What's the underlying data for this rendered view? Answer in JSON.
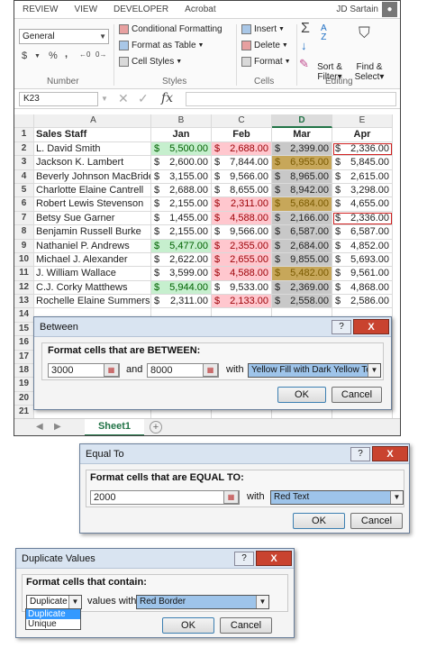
{
  "ribbon_tabs": [
    "REVIEW",
    "VIEW",
    "DEVELOPER",
    "Acrobat"
  ],
  "user": "JD Sartain",
  "number_group": {
    "format_value": "General",
    "label": "Number",
    "currency": "$",
    "percent": "%",
    "comma": ","
  },
  "styles_group": {
    "conditional": "Conditional Formatting",
    "format_table": "Format as Table",
    "cell_styles": "Cell Styles",
    "label": "Styles"
  },
  "cells_group": {
    "insert": "Insert",
    "delete": "Delete",
    "format": "Format",
    "label": "Cells"
  },
  "editing_group": {
    "sort": "Sort &",
    "sort2": "Filter",
    "find": "Find &",
    "find2": "Select",
    "label": "Editing"
  },
  "name_box": "K23",
  "formula_fx": "fx",
  "columns": [
    "A",
    "B",
    "C",
    "D",
    "E"
  ],
  "header_row": {
    "a": "Sales Staff",
    "b": "Jan",
    "c": "Feb",
    "d": "Mar",
    "e": "Apr"
  },
  "rows": [
    {
      "n": "2",
      "name": "L. David Smith",
      "jan": "5,500.00",
      "feb": "2,688.00",
      "mar": "2,399.00",
      "apr": "2,336.00",
      "fb": "green",
      "fc": "pink",
      "fd": "gray",
      "fe": "redborder"
    },
    {
      "n": "3",
      "name": "Jackson K. Lambert",
      "jan": "2,600.00",
      "feb": "7,844.00",
      "mar": "6,955.00",
      "apr": "5,845.00",
      "fb": "",
      "fc": "",
      "fd": "yellow",
      "fe": ""
    },
    {
      "n": "4",
      "name": "Beverly Johnson MacBride",
      "jan": "3,155.00",
      "feb": "9,566.00",
      "mar": "8,965.00",
      "apr": "2,615.00",
      "fb": "",
      "fc": "",
      "fd": "gray",
      "fe": ""
    },
    {
      "n": "5",
      "name": "Charlotte Elaine Cantrell",
      "jan": "2,688.00",
      "feb": "8,655.00",
      "mar": "8,942.00",
      "apr": "3,298.00",
      "fb": "",
      "fc": "",
      "fd": "gray",
      "fe": ""
    },
    {
      "n": "6",
      "name": "Robert Lewis Stevenson",
      "jan": "2,155.00",
      "feb": "2,311.00",
      "mar": "5,684.00",
      "apr": "4,655.00",
      "fb": "",
      "fc": "pink",
      "fd": "yellow",
      "fe": ""
    },
    {
      "n": "7",
      "name": "Betsy Sue Garner",
      "jan": "1,455.00",
      "feb": "4,588.00",
      "mar": "2,166.00",
      "apr": "2,336.00",
      "fb": "",
      "fc": "pink",
      "fd": "gray",
      "fe": "redborder"
    },
    {
      "n": "8",
      "name": "Benjamin Russell Burke",
      "jan": "2,155.00",
      "feb": "9,566.00",
      "mar": "6,587.00",
      "apr": "6,587.00",
      "fb": "",
      "fc": "",
      "fd": "gray",
      "fe": ""
    },
    {
      "n": "9",
      "name": "Nathaniel P. Andrews",
      "jan": "5,477.00",
      "feb": "2,355.00",
      "mar": "2,684.00",
      "apr": "4,852.00",
      "fb": "green",
      "fc": "pink",
      "fd": "gray",
      "fe": ""
    },
    {
      "n": "10",
      "name": "Michael J. Alexander",
      "jan": "2,622.00",
      "feb": "2,655.00",
      "mar": "9,855.00",
      "apr": "5,693.00",
      "fb": "",
      "fc": "pink",
      "fd": "gray",
      "fe": ""
    },
    {
      "n": "11",
      "name": "J. William Wallace",
      "jan": "3,599.00",
      "feb": "4,588.00",
      "mar": "5,482.00",
      "apr": "9,561.00",
      "fb": "",
      "fc": "pink",
      "fd": "yellow",
      "fe": ""
    },
    {
      "n": "12",
      "name": "C.J. Corky Matthews",
      "jan": "5,944.00",
      "feb": "9,533.00",
      "mar": "2,369.00",
      "apr": "4,868.00",
      "fb": "green",
      "fc": "",
      "fd": "gray",
      "fe": ""
    },
    {
      "n": "13",
      "name": "Rochelle Elaine Summers",
      "jan": "2,311.00",
      "feb": "2,133.00",
      "mar": "2,558.00",
      "apr": "2,586.00",
      "fb": "",
      "fc": "pink",
      "fd": "gray",
      "fe": ""
    }
  ],
  "empty_rows": [
    "14",
    "15",
    "16",
    "17",
    "18",
    "19",
    "20",
    "21"
  ],
  "row1": "1",
  "currency_symbol": "$",
  "sheet_tab": "Sheet1",
  "add_sheet": "+",
  "between_dialog": {
    "title": "Between",
    "label": "Format cells that are BETWEEN:",
    "low": "3000",
    "and": "and",
    "high": "8000",
    "with": "with",
    "format": "Yellow Fill with Dark Yellow Text",
    "ok": "OK",
    "cancel": "Cancel",
    "help": "?",
    "close": "X"
  },
  "equal_dialog": {
    "title": "Equal To",
    "label": "Format cells that are EQUAL TO:",
    "value": "2000",
    "with": "with",
    "format": "Red Text",
    "ok": "OK",
    "cancel": "Cancel",
    "help": "?",
    "close": "X"
  },
  "dup_dialog": {
    "title": "Duplicate Values",
    "label": "Format cells that contain:",
    "type": "Duplicate",
    "values_with": "values with",
    "format": "Red Border",
    "options": [
      "Duplicate",
      "Unique"
    ],
    "ok": "OK",
    "cancel": "Cancel",
    "help": "?",
    "close": "X"
  },
  "colors": {
    "green_fill": "#c6efce",
    "pink_fill": "#ffc7ce",
    "yellow_fill": "#c7a75a",
    "red_border": "#d02020",
    "excel_green": "#217346"
  }
}
